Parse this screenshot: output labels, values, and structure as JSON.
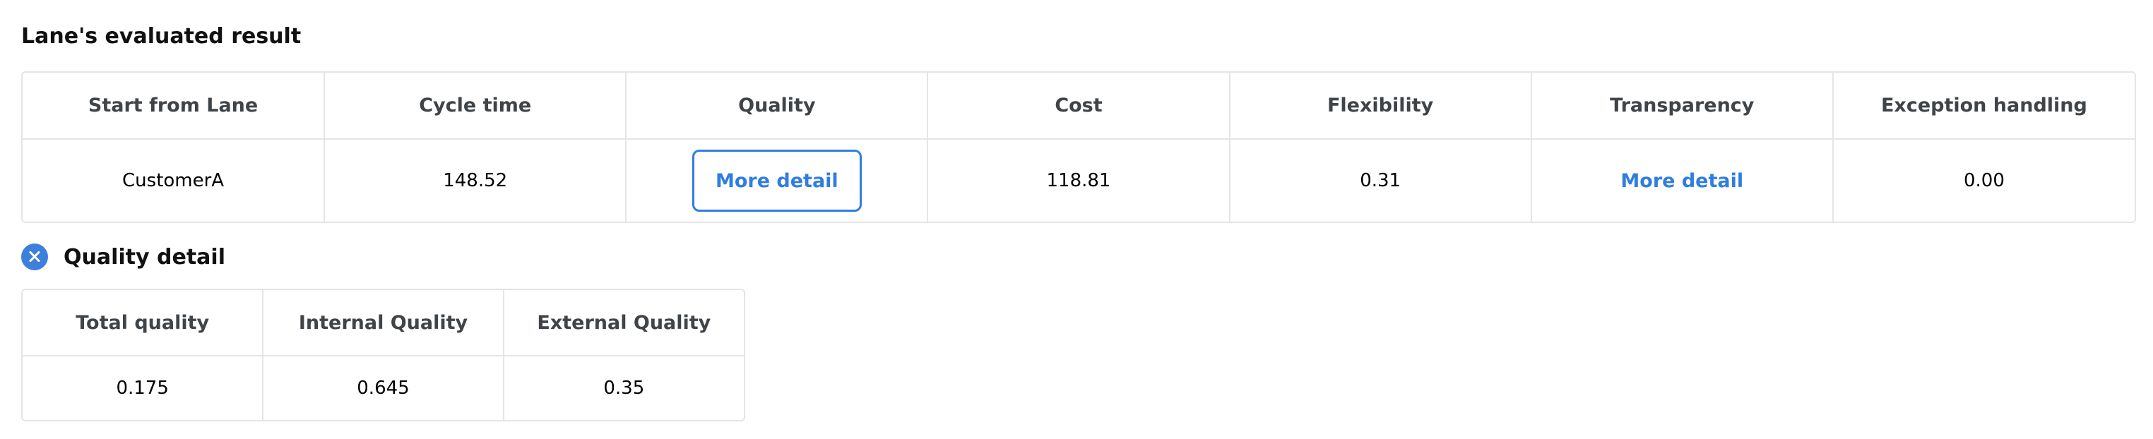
{
  "result": {
    "title": "Lane's evaluated result",
    "columns": [
      "Start from Lane",
      "Cycle time",
      "Quality",
      "Cost",
      "Flexibility",
      "Transparency",
      "Exception handling"
    ],
    "row": {
      "start_from_lane": "CustomerA",
      "cycle_time": "148.52",
      "quality_action": "More detail",
      "cost": "118.81",
      "flexibility": "0.31",
      "transparency_action": "More detail",
      "exception_handling": "0.00"
    }
  },
  "quality_detail": {
    "title": "Quality detail",
    "close_icon": "close-circle-icon",
    "columns": [
      "Total quality",
      "Internal Quality",
      "External Quality"
    ],
    "row": [
      "0.175",
      "0.645",
      "0.35"
    ]
  },
  "colors": {
    "accent": "#2f7de1",
    "border": "#e3e5e8",
    "header_text": "#3f4449"
  }
}
